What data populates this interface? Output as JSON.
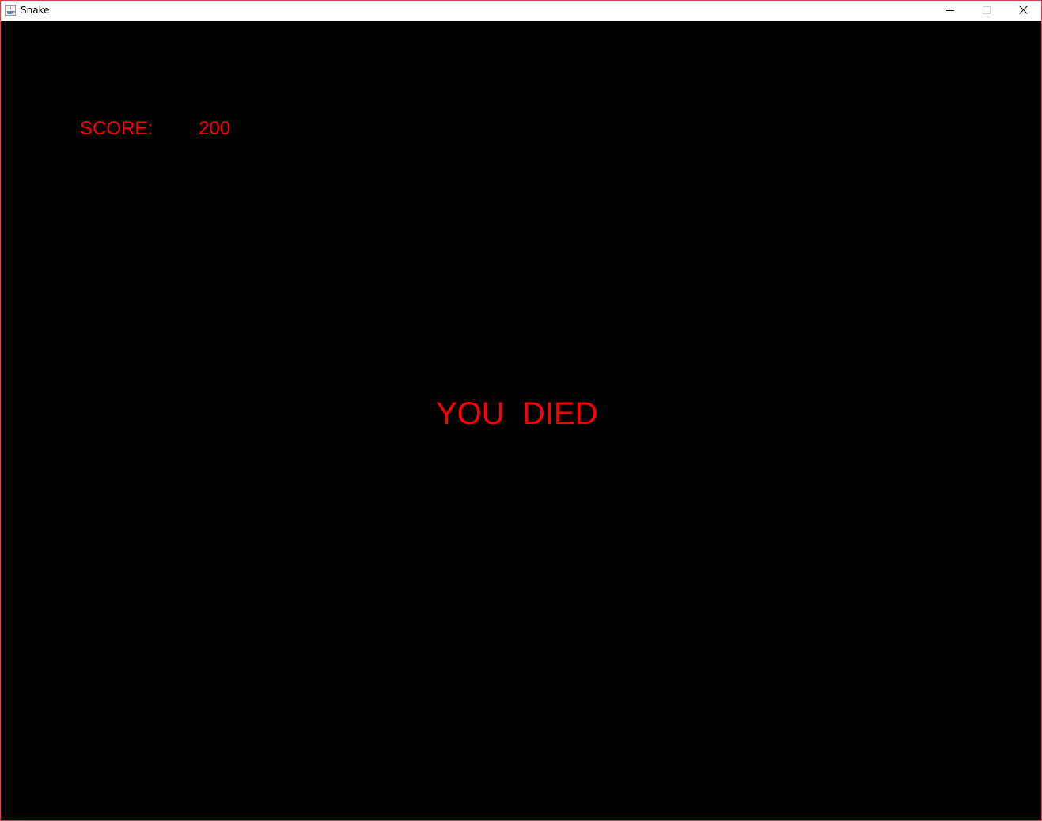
{
  "window": {
    "title": "Snake",
    "icon": "java-coffee-cup-icon",
    "controls": [
      "minimize-icon",
      "maximize-icon",
      "close-icon"
    ],
    "border_color": "#d9434d"
  },
  "game": {
    "background_color": "#000000",
    "text_color": "#ff0000",
    "score_label": "SCORE:",
    "score_value": "200",
    "status_message": "YOU  DIED"
  }
}
